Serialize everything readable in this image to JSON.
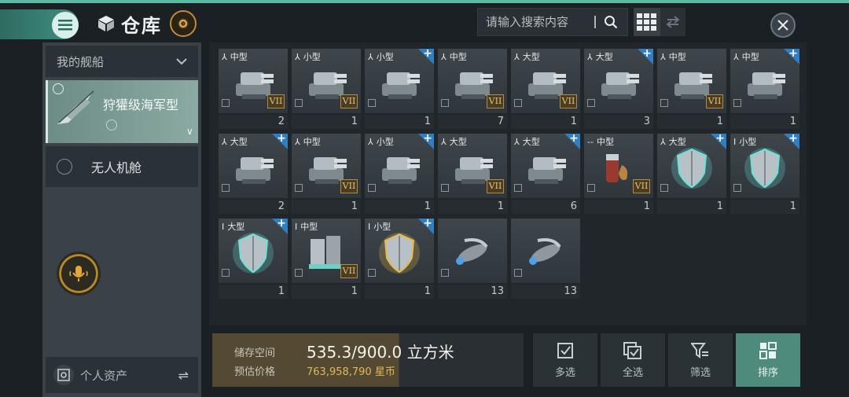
{
  "header": {
    "title": "仓库",
    "search_placeholder": "请输入搜索内容"
  },
  "sidebar": {
    "section_title": "我的舰船",
    "ship_name": "狩獾级海军型",
    "drone_bay": "无人机舱",
    "personal_assets": "个人资产"
  },
  "items": [
    {
      "size": "中型",
      "qty": "2",
      "rank": "VII",
      "plus": false,
      "mark": "⅄",
      "icon": "turret-icon"
    },
    {
      "size": "小型",
      "qty": "1",
      "rank": "VII",
      "plus": false,
      "mark": "⅄",
      "icon": "launcher-icon"
    },
    {
      "size": "小型",
      "qty": "1",
      "rank": "",
      "plus": true,
      "mark": "⅄",
      "icon": "launcher-icon"
    },
    {
      "size": "中型",
      "qty": "7",
      "rank": "VII",
      "plus": false,
      "mark": "⅄",
      "icon": "cannon-icon"
    },
    {
      "size": "大型",
      "qty": "1",
      "rank": "VII",
      "plus": false,
      "mark": "⅄",
      "icon": "turret-base-icon"
    },
    {
      "size": "大型",
      "qty": "3",
      "rank": "",
      "plus": true,
      "mark": "⅄",
      "icon": "turret-base-icon"
    },
    {
      "size": "中型",
      "qty": "1",
      "rank": "VII",
      "plus": false,
      "mark": "⅄",
      "icon": "autocannon-icon"
    },
    {
      "size": "中型",
      "qty": "1",
      "rank": "",
      "plus": true,
      "mark": "⅄",
      "icon": "autocannon-icon"
    },
    {
      "size": "大型",
      "qty": "2",
      "rank": "",
      "plus": true,
      "mark": "⅄",
      "icon": "launcher-icon"
    },
    {
      "size": "中型",
      "qty": "1",
      "rank": "VII",
      "plus": false,
      "mark": "⅄",
      "icon": "missile-pod-icon"
    },
    {
      "size": "小型",
      "qty": "1",
      "rank": "",
      "plus": true,
      "mark": "⅄",
      "icon": "laser-turret-icon"
    },
    {
      "size": "大型",
      "qty": "1",
      "rank": "VII",
      "plus": false,
      "mark": "⅄",
      "icon": "platform-icon"
    },
    {
      "size": "大型",
      "qty": "6",
      "rank": "",
      "plus": true,
      "mark": "⅄",
      "icon": "platform-icon"
    },
    {
      "size": "中型",
      "qty": "1",
      "rank": "VII",
      "plus": false,
      "mark": "--",
      "icon": "ammo-icon"
    },
    {
      "size": "大型",
      "qty": "1",
      "rank": "",
      "plus": true,
      "mark": "⅄",
      "icon": "shield-icon"
    },
    {
      "size": "小型",
      "qty": "1",
      "rank": "",
      "plus": true,
      "mark": "I",
      "icon": "shield-icon"
    },
    {
      "size": "大型",
      "qty": "1",
      "rank": "",
      "plus": true,
      "mark": "I",
      "icon": "shield-icon"
    },
    {
      "size": "中型",
      "qty": "1",
      "rank": "VII",
      "plus": false,
      "mark": "I",
      "icon": "armor-plate-icon"
    },
    {
      "size": "小型",
      "qty": "1",
      "rank": "",
      "plus": true,
      "mark": "I",
      "icon": "gold-shield-icon"
    },
    {
      "size": "",
      "qty": "13",
      "rank": "",
      "plus": false,
      "mark": "",
      "icon": "drone-icon"
    },
    {
      "size": "",
      "qty": "13",
      "rank": "",
      "plus": false,
      "mark": "",
      "icon": "drone-icon"
    }
  ],
  "storage": {
    "space_label": "储存空间",
    "space_value": "535.3/900.0 立方米",
    "price_label": "预估价格",
    "price_value": "763,958,790 星币",
    "fill_fraction": 0.595
  },
  "actions": [
    {
      "label": "多选",
      "icon": "check-box-icon"
    },
    {
      "label": "全选",
      "icon": "check-all-icon"
    },
    {
      "label": "筛选",
      "icon": "filter-icon"
    },
    {
      "label": "排序",
      "icon": "sort-grid-icon"
    }
  ],
  "colors": {
    "accent": "#5fb8a4",
    "plus_badge": "#2f7fc2",
    "rank_gold": "#e3c27a",
    "price_gold": "#e3b756"
  }
}
